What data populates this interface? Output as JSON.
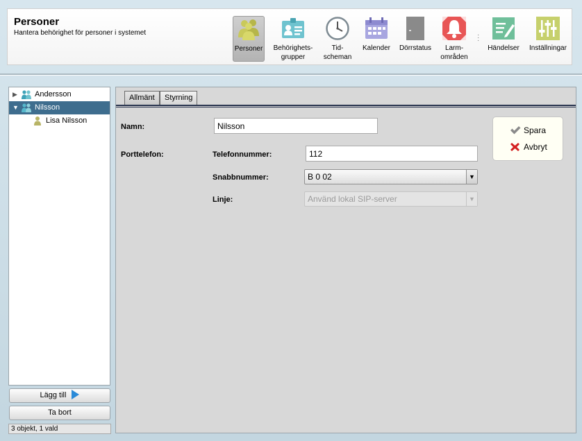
{
  "header": {
    "title": "Personer",
    "subtitle": "Hantera behörighet för personer i systemet"
  },
  "toolbar": [
    {
      "id": "personer",
      "line1": "Personer",
      "line2": "",
      "icon": "people-icon",
      "active": true
    },
    {
      "id": "behorighetsgrupper",
      "line1": "Behörighets-",
      "line2": "grupper",
      "icon": "id-card-icon",
      "active": false
    },
    {
      "id": "tidscheman",
      "line1": "Tid-",
      "line2": "scheman",
      "icon": "clock-icon",
      "active": false
    },
    {
      "id": "kalender",
      "line1": "Kalender",
      "line2": "",
      "icon": "calendar-icon",
      "active": false
    },
    {
      "id": "dorrstatus",
      "line1": "Dörrstatus",
      "line2": "",
      "icon": "door-icon",
      "active": false
    },
    {
      "id": "larmomraden",
      "line1": "Larm-",
      "line2": "områden",
      "icon": "alarm-bell-icon",
      "active": false
    },
    {
      "id": "handelser",
      "line1": "Händelser",
      "line2": "",
      "icon": "log-pencil-icon",
      "active": false
    },
    {
      "id": "installningar",
      "line1": "Inställningar",
      "line2": "",
      "icon": "sliders-icon",
      "active": false
    }
  ],
  "tree": {
    "items": [
      {
        "label": "Andersson",
        "level": 0,
        "expanded": false,
        "selected": false,
        "icon": "group-icon"
      },
      {
        "label": "Nilsson",
        "level": 0,
        "expanded": true,
        "selected": true,
        "icon": "group-icon"
      },
      {
        "label": "Lisa Nilsson",
        "level": 1,
        "expanded": false,
        "selected": false,
        "icon": "person-icon"
      }
    ]
  },
  "sidebar": {
    "add_label": "Lägg till",
    "remove_label": "Ta bort",
    "status": "3 objekt, 1 vald"
  },
  "tabs": [
    {
      "label": "Allmänt",
      "active": true
    },
    {
      "label": "Styrning",
      "active": false
    }
  ],
  "form": {
    "name_label": "Namn:",
    "name_value": "Nilsson",
    "porttelefon_label": "Porttelefon:",
    "telefon_label": "Telefonnummer:",
    "telefon_value": "112",
    "snabb_label": "Snabbnummer:",
    "snabb_value": "B 0 02",
    "linje_label": "Linje:",
    "linje_value": "Använd lokal SIP-server"
  },
  "actions": {
    "save_label": "Spara",
    "cancel_label": "Avbryt"
  },
  "colors": {
    "selection": "#3e6d8e",
    "save_check": "#8a8a8a",
    "cancel_x": "#d42020",
    "people_icon": "#c9c95a",
    "person_icon_teal": "#3fa3b8"
  }
}
